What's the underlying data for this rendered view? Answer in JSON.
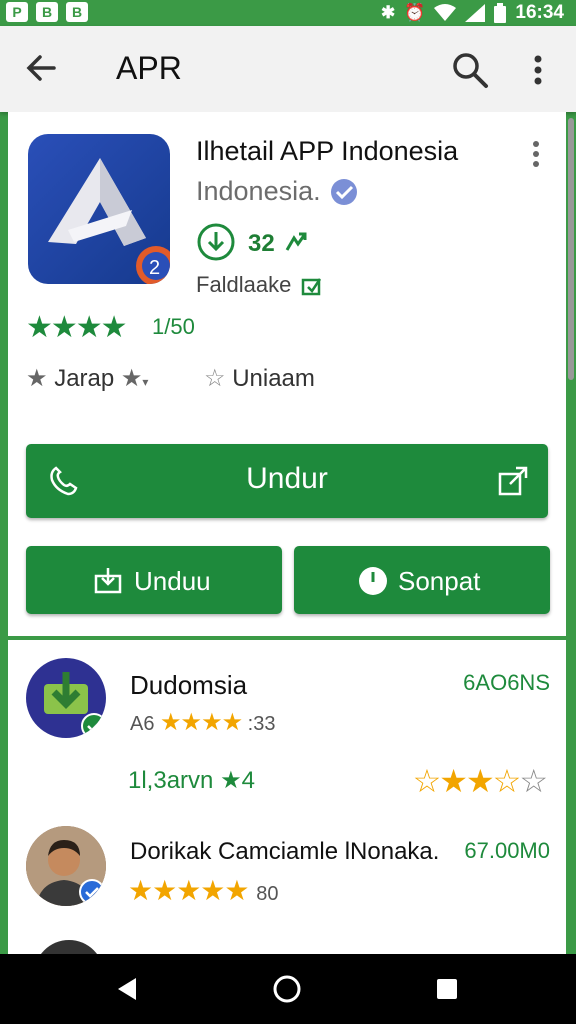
{
  "status": {
    "time": "16:34",
    "left_icons": [
      "P",
      "B",
      "B"
    ]
  },
  "appbar": {
    "title": "APR"
  },
  "app": {
    "name": "Ilhetail APP Indonesia",
    "developer": "Indonesia.",
    "download_count": "32",
    "category": "Faldlaake",
    "rating_text": "1/50",
    "tag1": "Jarap",
    "tag2": "Uniaam"
  },
  "buttons": {
    "main": "Undur",
    "left": "Unduu",
    "right": "Sonpat"
  },
  "reviews": [
    {
      "name": "Dudomsia",
      "date": "6AO6NS",
      "prefix": "A6",
      "score": "33",
      "helpful": "1l,3arvn",
      "count": "4",
      "rating": 3.5
    },
    {
      "name": "Dorikak Camciamle lNonaka.",
      "date": "67.00M0",
      "score": "80",
      "rating": 5
    }
  ],
  "colors": {
    "green": "#1e8a3c",
    "status_green": "#3b9a46",
    "star_yellow": "#f2a500"
  }
}
